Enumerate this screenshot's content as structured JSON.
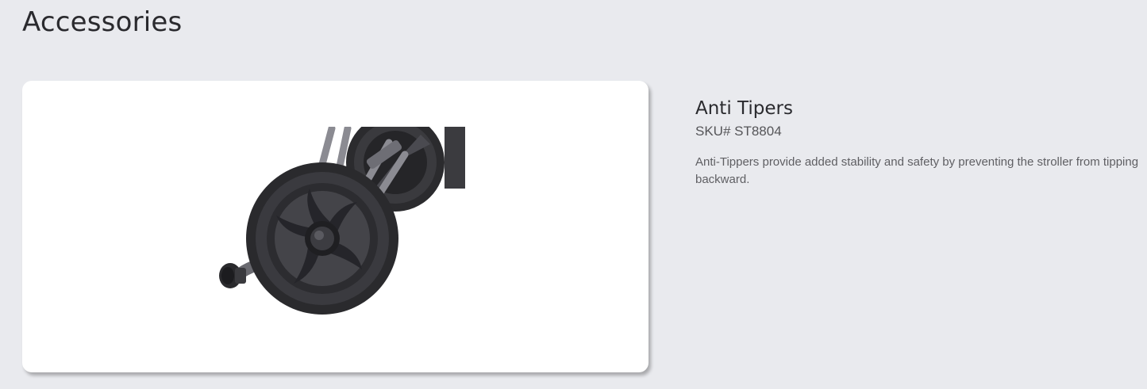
{
  "section": {
    "title": "Accessories"
  },
  "product": {
    "name": "Anti Tipers",
    "sku": "SKU# ST8804",
    "description": "Anti-Tippers provide added stability and safety by preventing the stroller from tipping backward.",
    "image_icon": "anti-tipper-wheel-photo"
  },
  "colors": {
    "page_background": "#e9eaee",
    "card_background": "#ffffff",
    "heading_text": "#2a2a2e",
    "body_text": "#5f5f63"
  }
}
